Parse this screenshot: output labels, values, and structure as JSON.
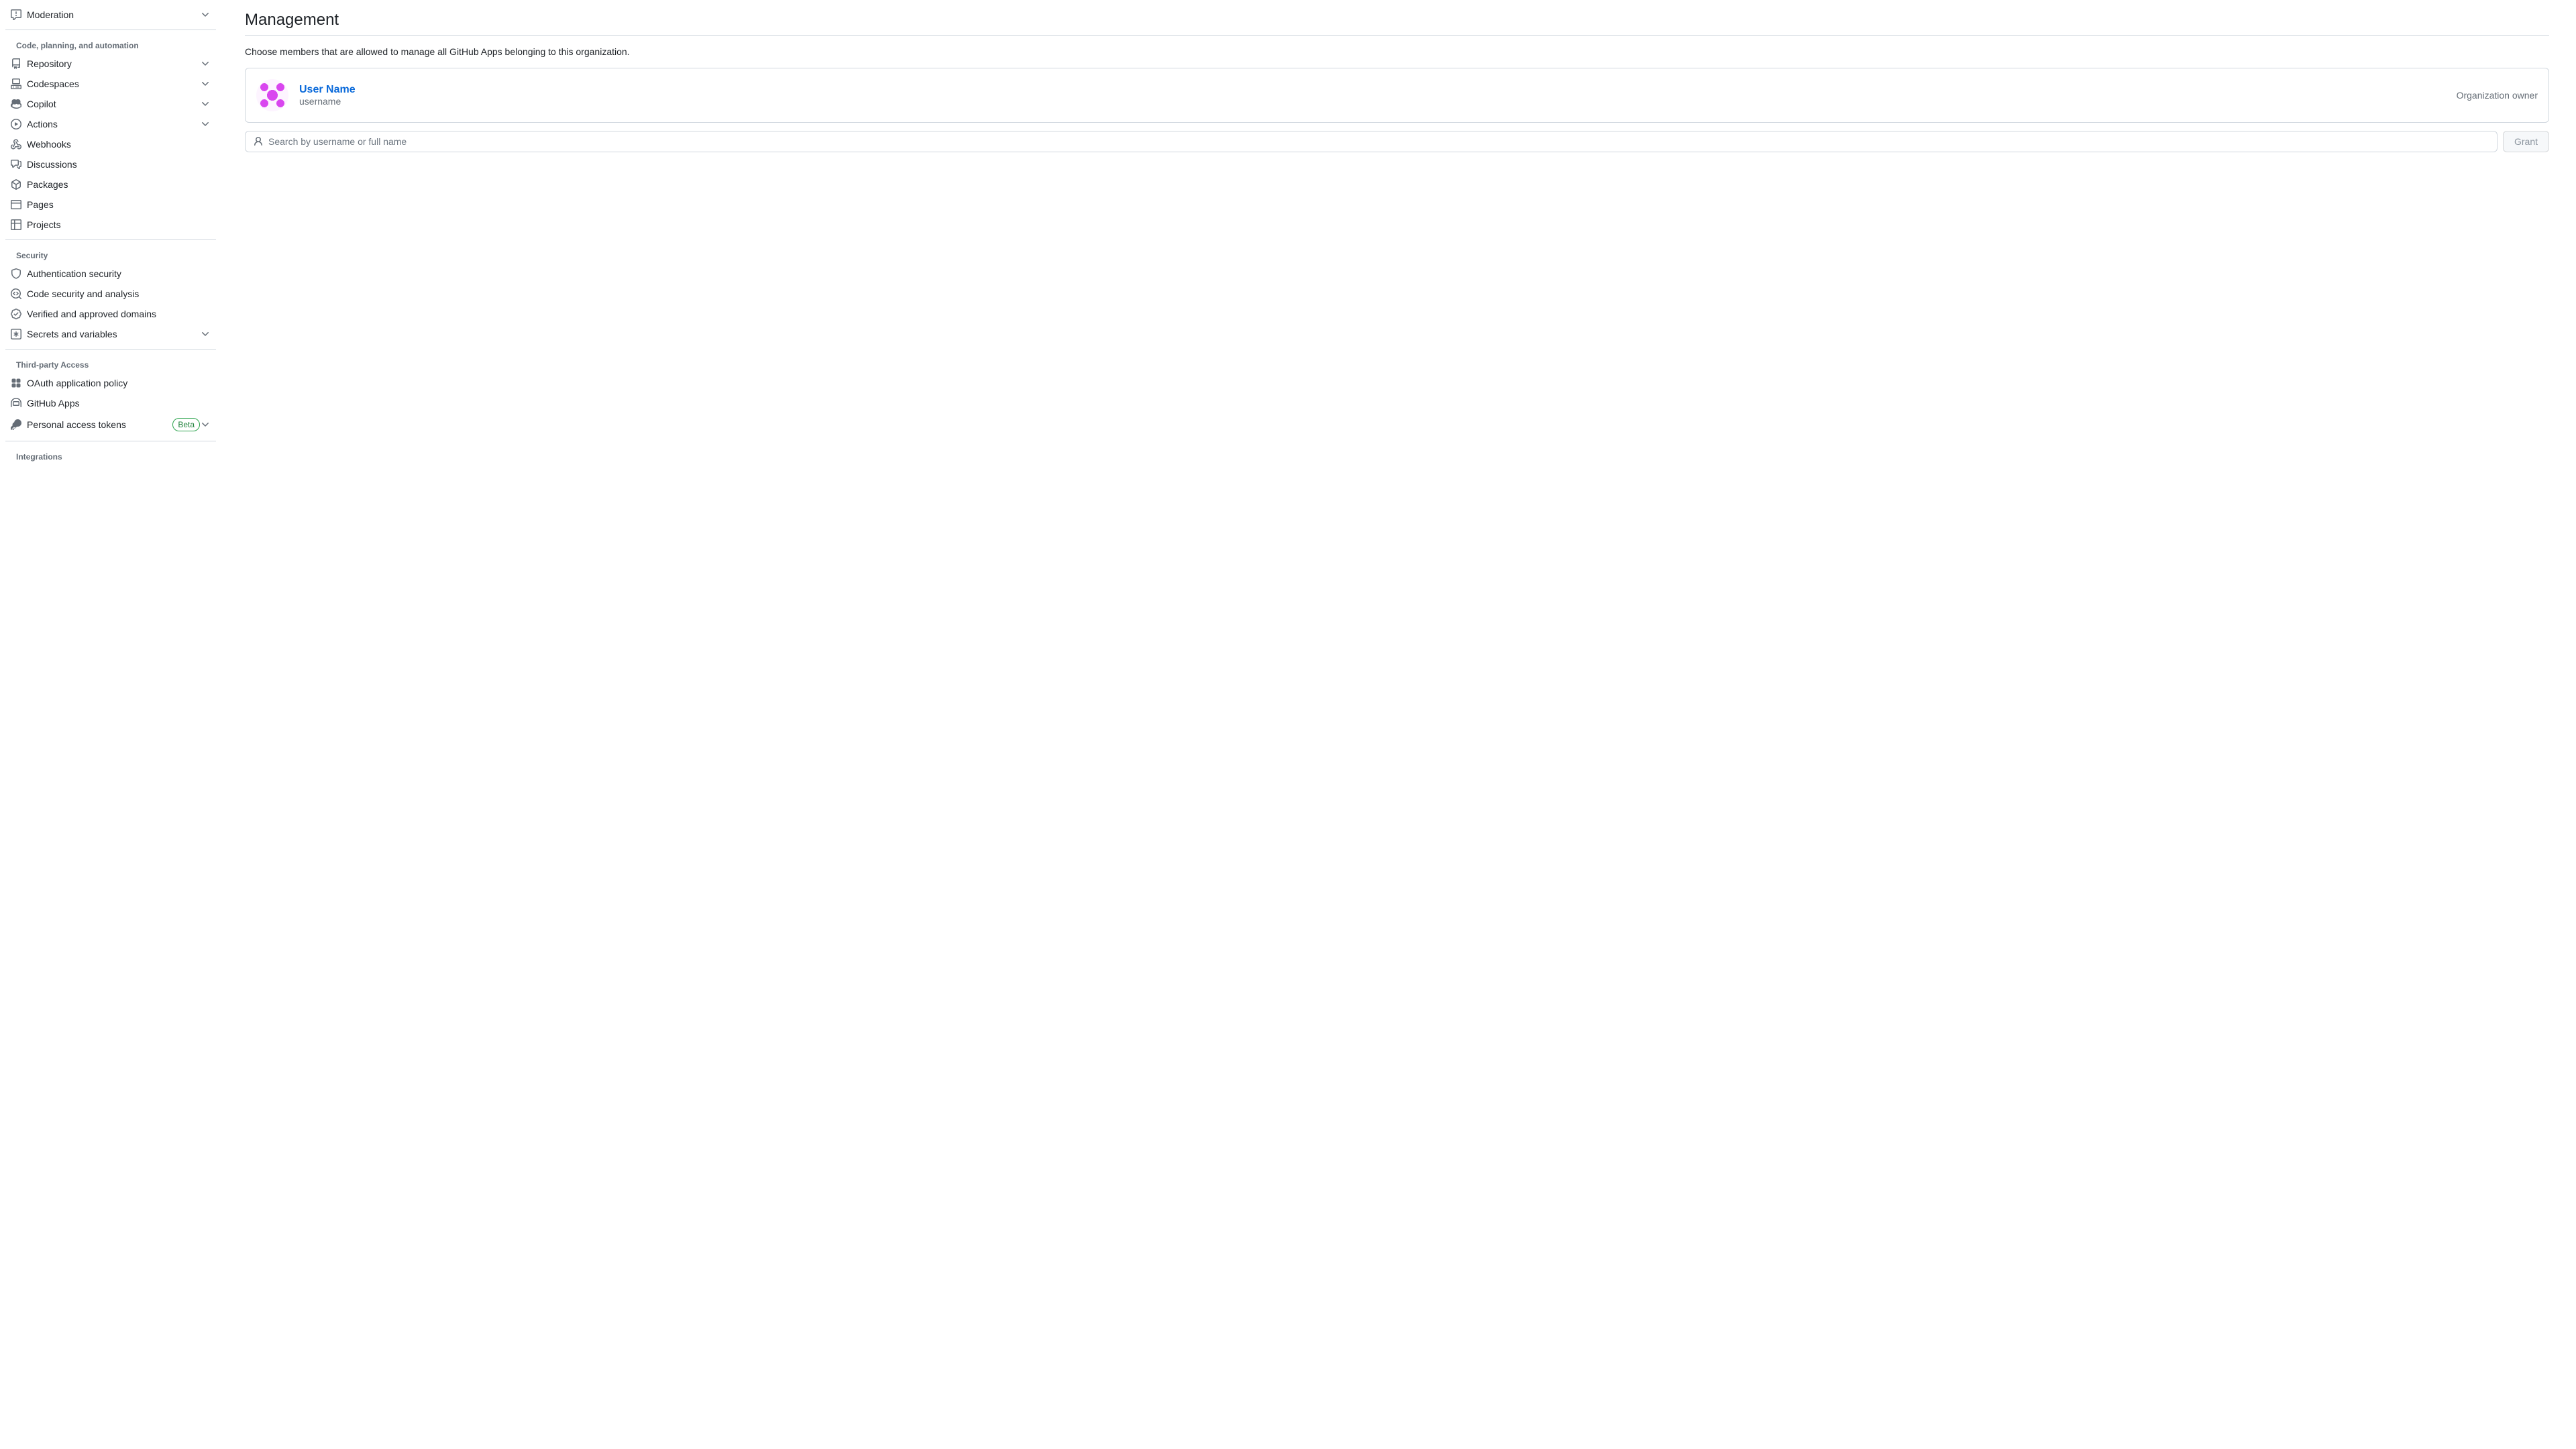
{
  "sidebar": {
    "s0": {
      "moderation": "Moderation"
    },
    "g1": {
      "header": "Code, planning, and automation",
      "repository": "Repository",
      "codespaces": "Codespaces",
      "copilot": "Copilot",
      "actions": "Actions",
      "webhooks": "Webhooks",
      "discussions": "Discussions",
      "packages": "Packages",
      "pages": "Pages",
      "projects": "Projects"
    },
    "g2": {
      "header": "Security",
      "auth": "Authentication security",
      "codesec": "Code security and analysis",
      "verified": "Verified and approved domains",
      "secrets": "Secrets and variables"
    },
    "g3": {
      "header": "Third-party Access",
      "oauth": "OAuth application policy",
      "ghapps": "GitHub Apps",
      "pat": "Personal access tokens",
      "pat_badge": "Beta"
    },
    "g4": {
      "header": "Integrations"
    }
  },
  "main": {
    "title": "Management",
    "desc": "Choose members that are allowed to manage all GitHub Apps belonging to this organization.",
    "member": {
      "name": "User Name",
      "username": "username",
      "role": "Organization owner"
    },
    "search_placeholder": "Search by username or full name",
    "grant_label": "Grant"
  }
}
